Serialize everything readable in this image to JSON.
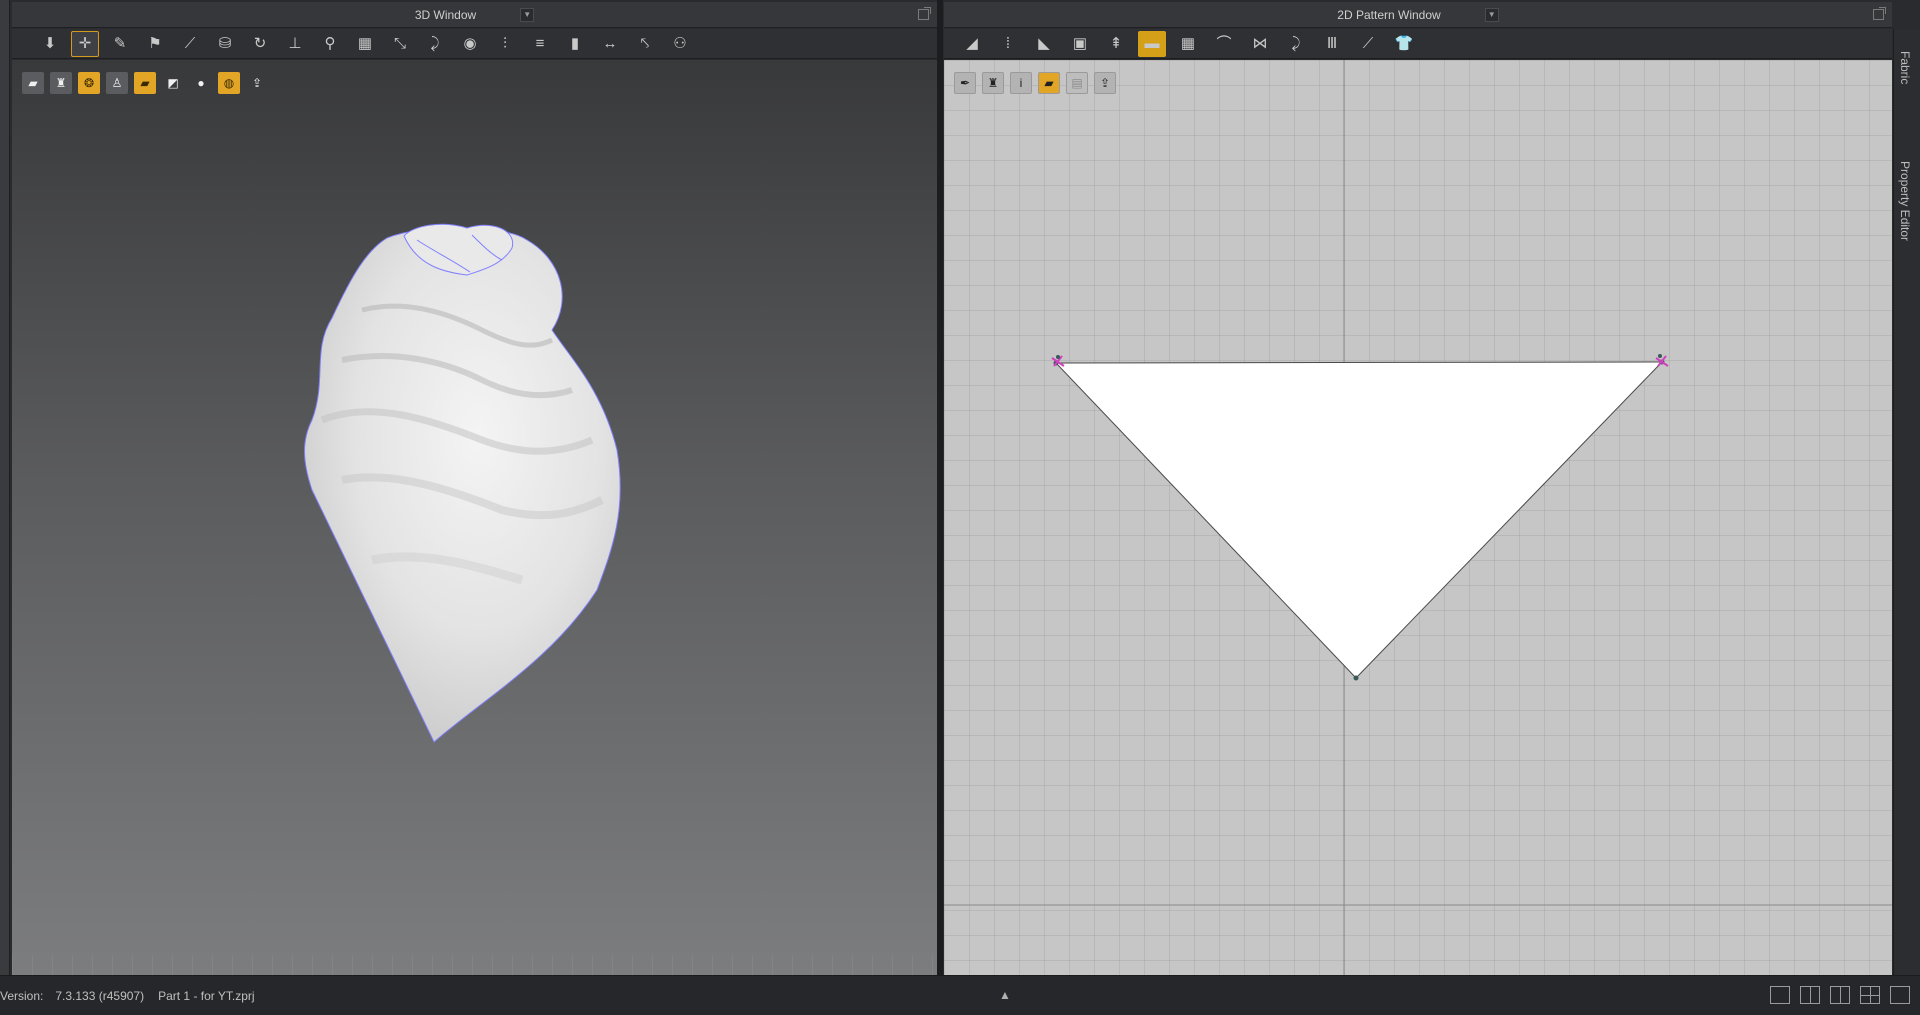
{
  "window_3d": {
    "title": "3D Window"
  },
  "window_2d": {
    "title": "2D Pattern Window"
  },
  "toolbar_3d": [
    {
      "name": "select-mesh",
      "glyph": "⬇"
    },
    {
      "name": "move",
      "glyph": "✛",
      "active": true
    },
    {
      "name": "brush",
      "glyph": "✎"
    },
    {
      "name": "gather",
      "glyph": "⚑"
    },
    {
      "name": "draw-line",
      "glyph": "⟋"
    },
    {
      "name": "arrangement",
      "glyph": "⛁"
    },
    {
      "name": "rotate",
      "glyph": "↻"
    },
    {
      "name": "pin",
      "glyph": "⊥"
    },
    {
      "name": "tack",
      "glyph": "⚲"
    },
    {
      "name": "mesh-grid",
      "glyph": "▦"
    },
    {
      "name": "cut",
      "glyph": "⤡"
    },
    {
      "name": "sew",
      "glyph": "⤸"
    },
    {
      "name": "button",
      "glyph": "◉"
    },
    {
      "name": "zipper",
      "glyph": "⫶"
    },
    {
      "name": "puckering",
      "glyph": "≡"
    },
    {
      "name": "measure",
      "glyph": "▮"
    },
    {
      "name": "circumference",
      "glyph": "↔"
    },
    {
      "name": "tape",
      "glyph": "⤣"
    },
    {
      "name": "avatar-pose",
      "glyph": "⚇"
    }
  ],
  "toolbar_2d": [
    {
      "name": "transform-pattern",
      "glyph": "◢"
    },
    {
      "name": "edit-pattern",
      "glyph": "⁞"
    },
    {
      "name": "polygon",
      "glyph": "◣"
    },
    {
      "name": "rectangle",
      "glyph": "▣"
    },
    {
      "name": "internal-line",
      "glyph": "⇞"
    },
    {
      "name": "texture",
      "glyph": "▬",
      "active": true
    },
    {
      "name": "grid-2d",
      "glyph": "▦"
    },
    {
      "name": "fold",
      "glyph": "⌒"
    },
    {
      "name": "seam-segment",
      "glyph": "⋈"
    },
    {
      "name": "free-sewing",
      "glyph": "⤸"
    },
    {
      "name": "pleat",
      "glyph": "Ⅲ"
    },
    {
      "name": "trace",
      "glyph": "⟋"
    },
    {
      "name": "garment",
      "glyph": "👕"
    }
  ],
  "sub_toolbar_3d": [
    {
      "name": "display-cloth",
      "glyph": "▰"
    },
    {
      "name": "display-shirt",
      "glyph": "♜"
    },
    {
      "name": "display-texture",
      "glyph": "❂",
      "orange": true
    },
    {
      "name": "display-avatar",
      "glyph": "♙"
    },
    {
      "name": "display-fabric",
      "glyph": "▰",
      "orange": true
    },
    {
      "name": "display-surface",
      "glyph": "◩",
      "plain": true
    },
    {
      "name": "display-head",
      "glyph": "●",
      "plain": true
    },
    {
      "name": "display-globe",
      "glyph": "◍",
      "orange": true
    },
    {
      "name": "display-export",
      "glyph": "⇪",
      "plain": true
    }
  ],
  "sub_toolbar_2d": [
    {
      "name": "view-visibility",
      "glyph": "✒"
    },
    {
      "name": "view-garment",
      "glyph": "♜"
    },
    {
      "name": "view-info",
      "glyph": "i"
    },
    {
      "name": "view-fabric",
      "glyph": "▰",
      "orange": true
    },
    {
      "name": "view-layer",
      "glyph": "▤",
      "dim": true
    },
    {
      "name": "view-export",
      "glyph": "⇪"
    }
  ],
  "side_tabs": {
    "fabric": "Fabric",
    "property_editor": "Property Editor"
  },
  "status": {
    "version_label": "Version:",
    "version_value": "7.3.133 (r45907)",
    "file": "Part 1 - for YT.zprj"
  },
  "colors": {
    "accent": "#d4a018",
    "seam_line": "#8080ff",
    "pattern_fill": "#ffffff",
    "point_marker": "#d040c0"
  }
}
